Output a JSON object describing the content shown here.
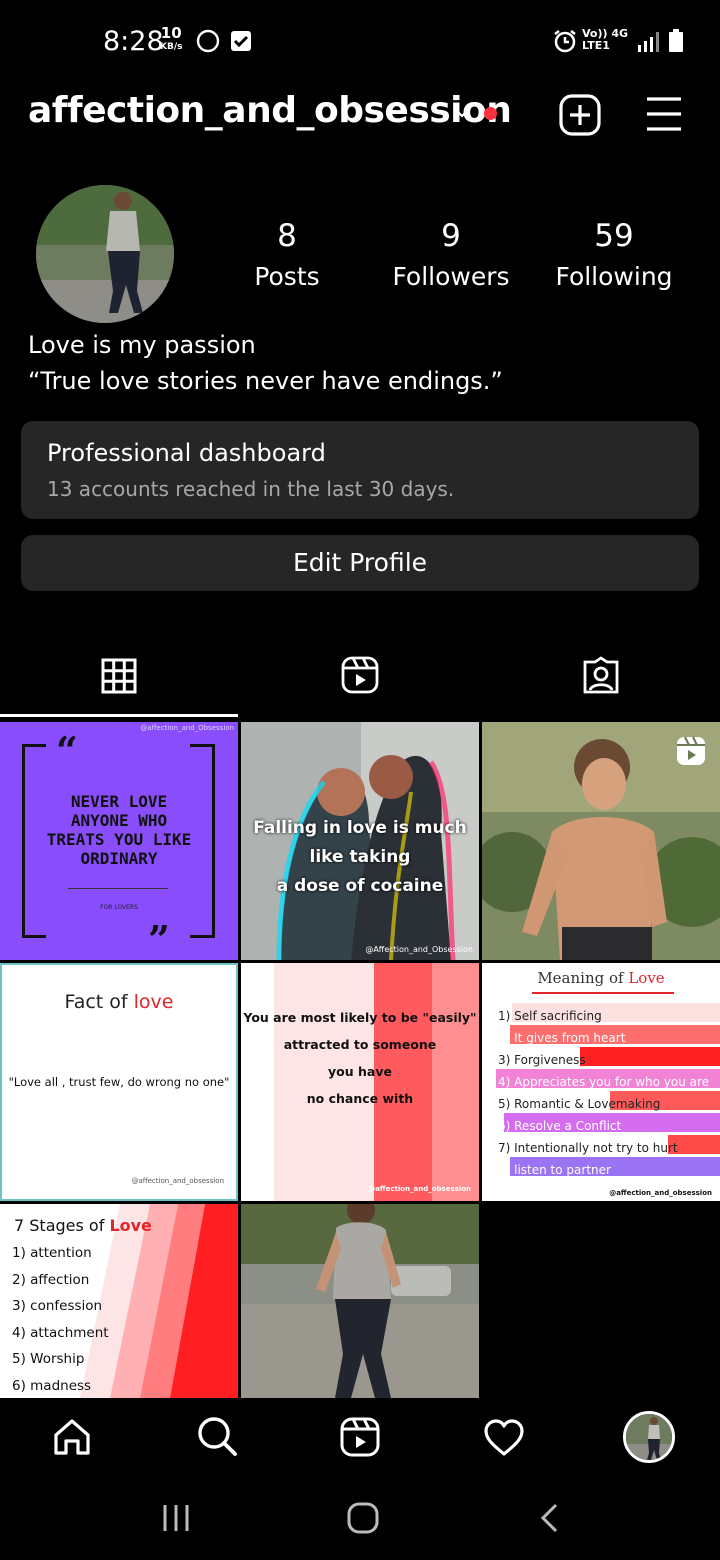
{
  "status_bar": {
    "time": "8:28",
    "net_speed": "10",
    "net_unit": "KB/s",
    "carrier_top": "Vo)) 4G",
    "carrier_bottom": "LTE1"
  },
  "header": {
    "username": "affection_and_obsession"
  },
  "profile": {
    "stats": [
      {
        "value": "8",
        "label": "Posts"
      },
      {
        "value": "9",
        "label": "Followers"
      },
      {
        "value": "59",
        "label": "Following"
      }
    ],
    "bio_line1": "Love is my passion",
    "bio_line2": "“True love stories never have endings.”"
  },
  "dashboard": {
    "title": "Professional dashboard",
    "subtitle": "13 accounts reached in the last 30 days."
  },
  "edit_profile_label": "Edit Profile",
  "posts": {
    "p1": {
      "watermark": "@affection_and_Obsession",
      "lines": [
        "NEVER LOVE",
        "ANYONE WHO",
        "TREATS YOU LIKE",
        "ORDINARY"
      ],
      "footer": "FOR LOVERS"
    },
    "p2": {
      "lines": [
        "Falling in love is much",
        "like taking",
        "a dose of cocaine"
      ],
      "watermark": "@Affection_and_Obsession"
    },
    "p4": {
      "title_a": "Fact of ",
      "title_b": "love",
      "quote": "\"Love all , trust few, do wrong no one\"",
      "watermark": "@affection_and_obsession"
    },
    "p5": {
      "lines": [
        "You are most likely to be \"easily\"",
        "attracted to someone",
        "you have",
        "no chance with"
      ],
      "watermark": "@affection_and_obsession"
    },
    "p6": {
      "title_a": "Meaning of ",
      "title_b": "Love",
      "items": [
        "1)  Self sacrificing",
        "2) It gives from heart",
        "3) Forgiveness",
        "4) Appreciates you for who you are",
        "5) Romantic & Lovemaking",
        "6) Resolve a Conflict",
        "7) Intentionally not try to hurt",
        "8) listen to partner"
      ],
      "watermark": "@affection_and_obsession"
    },
    "p7": {
      "title_a": "7 Stages of ",
      "title_b": "Love",
      "items": [
        "1) attention",
        "2) affection",
        "3) confession",
        "4) attachment",
        "5) Worship",
        "6) madness"
      ]
    }
  },
  "colors": {
    "accent_red": "#ff3040",
    "card_bg": "#262626",
    "purple_post": "#8a4dfb"
  }
}
